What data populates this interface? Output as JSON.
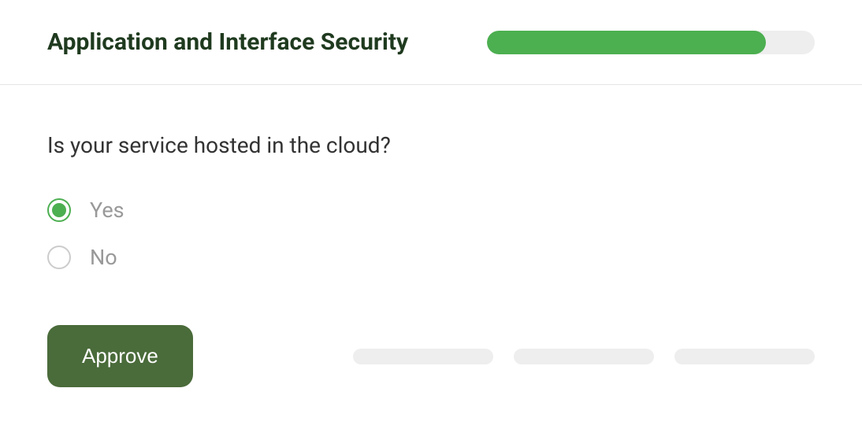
{
  "header": {
    "title": "Application and Interface Security",
    "progress_percent": 85
  },
  "question": {
    "text": "Is your service hosted in the cloud?",
    "options": [
      {
        "label": "Yes",
        "selected": true
      },
      {
        "label": "No",
        "selected": false
      }
    ]
  },
  "actions": {
    "approve_label": "Approve"
  }
}
